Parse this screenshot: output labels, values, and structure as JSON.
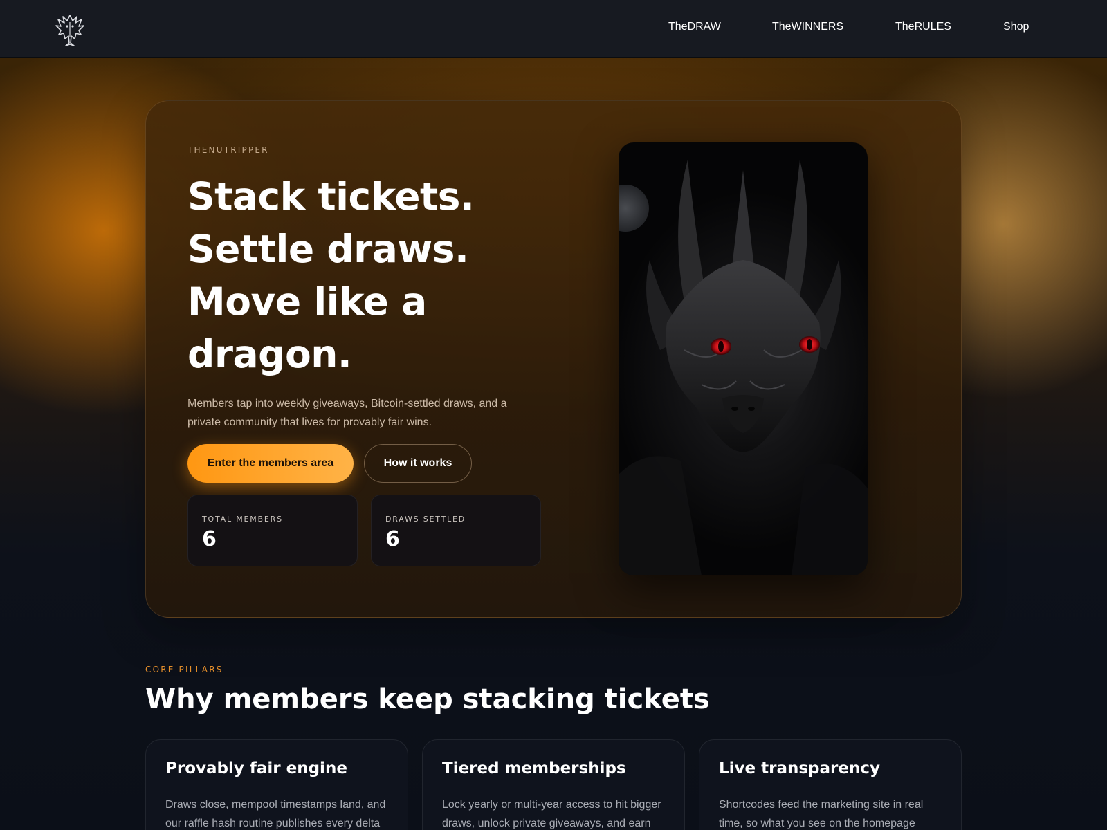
{
  "header": {
    "logo_icon": "dragon-emblem-icon",
    "nav": [
      {
        "label": "TheDRAW"
      },
      {
        "label": "TheWINNERS"
      },
      {
        "label": "TheRULES"
      },
      {
        "label": "Shop"
      }
    ]
  },
  "hero": {
    "eyebrow": "THENUTRIPPER",
    "title_lines": [
      "Stack tickets.",
      "Settle draws.",
      "Move like a",
      "dragon."
    ],
    "description": "Members tap into weekly giveaways, Bitcoin-settled draws, and a private community that lives for provably fair wins.",
    "primary_cta": "Enter the members area",
    "secondary_cta": "How it works",
    "stats": [
      {
        "label": "TOTAL MEMBERS",
        "value": "6"
      },
      {
        "label": "DRAWS SETTLED",
        "value": "6"
      }
    ],
    "image_icon": "dragon-portrait"
  },
  "pillars": {
    "eyebrow": "CORE PILLARS",
    "title": "Why members keep stacking tickets",
    "cards": [
      {
        "title": "Provably fair engine",
        "text": "Draws close, mempool timestamps land, and our raffle hash routine publishes every delta"
      },
      {
        "title": "Tiered memberships",
        "text": "Lock yearly or multi-year access to hit bigger draws, unlock private giveaways, and earn"
      },
      {
        "title": "Live transparency",
        "text": "Shortcodes feed the marketing site in real time, so what you see on the homepage"
      }
    ]
  },
  "colors": {
    "accent": "#ff9712",
    "accent_light": "#ffb347",
    "eyebrow_orange": "#e58f2b",
    "header_bg": "#171a21",
    "page_bg": "#0b0f18",
    "dragon_eye": "#e0141b"
  }
}
